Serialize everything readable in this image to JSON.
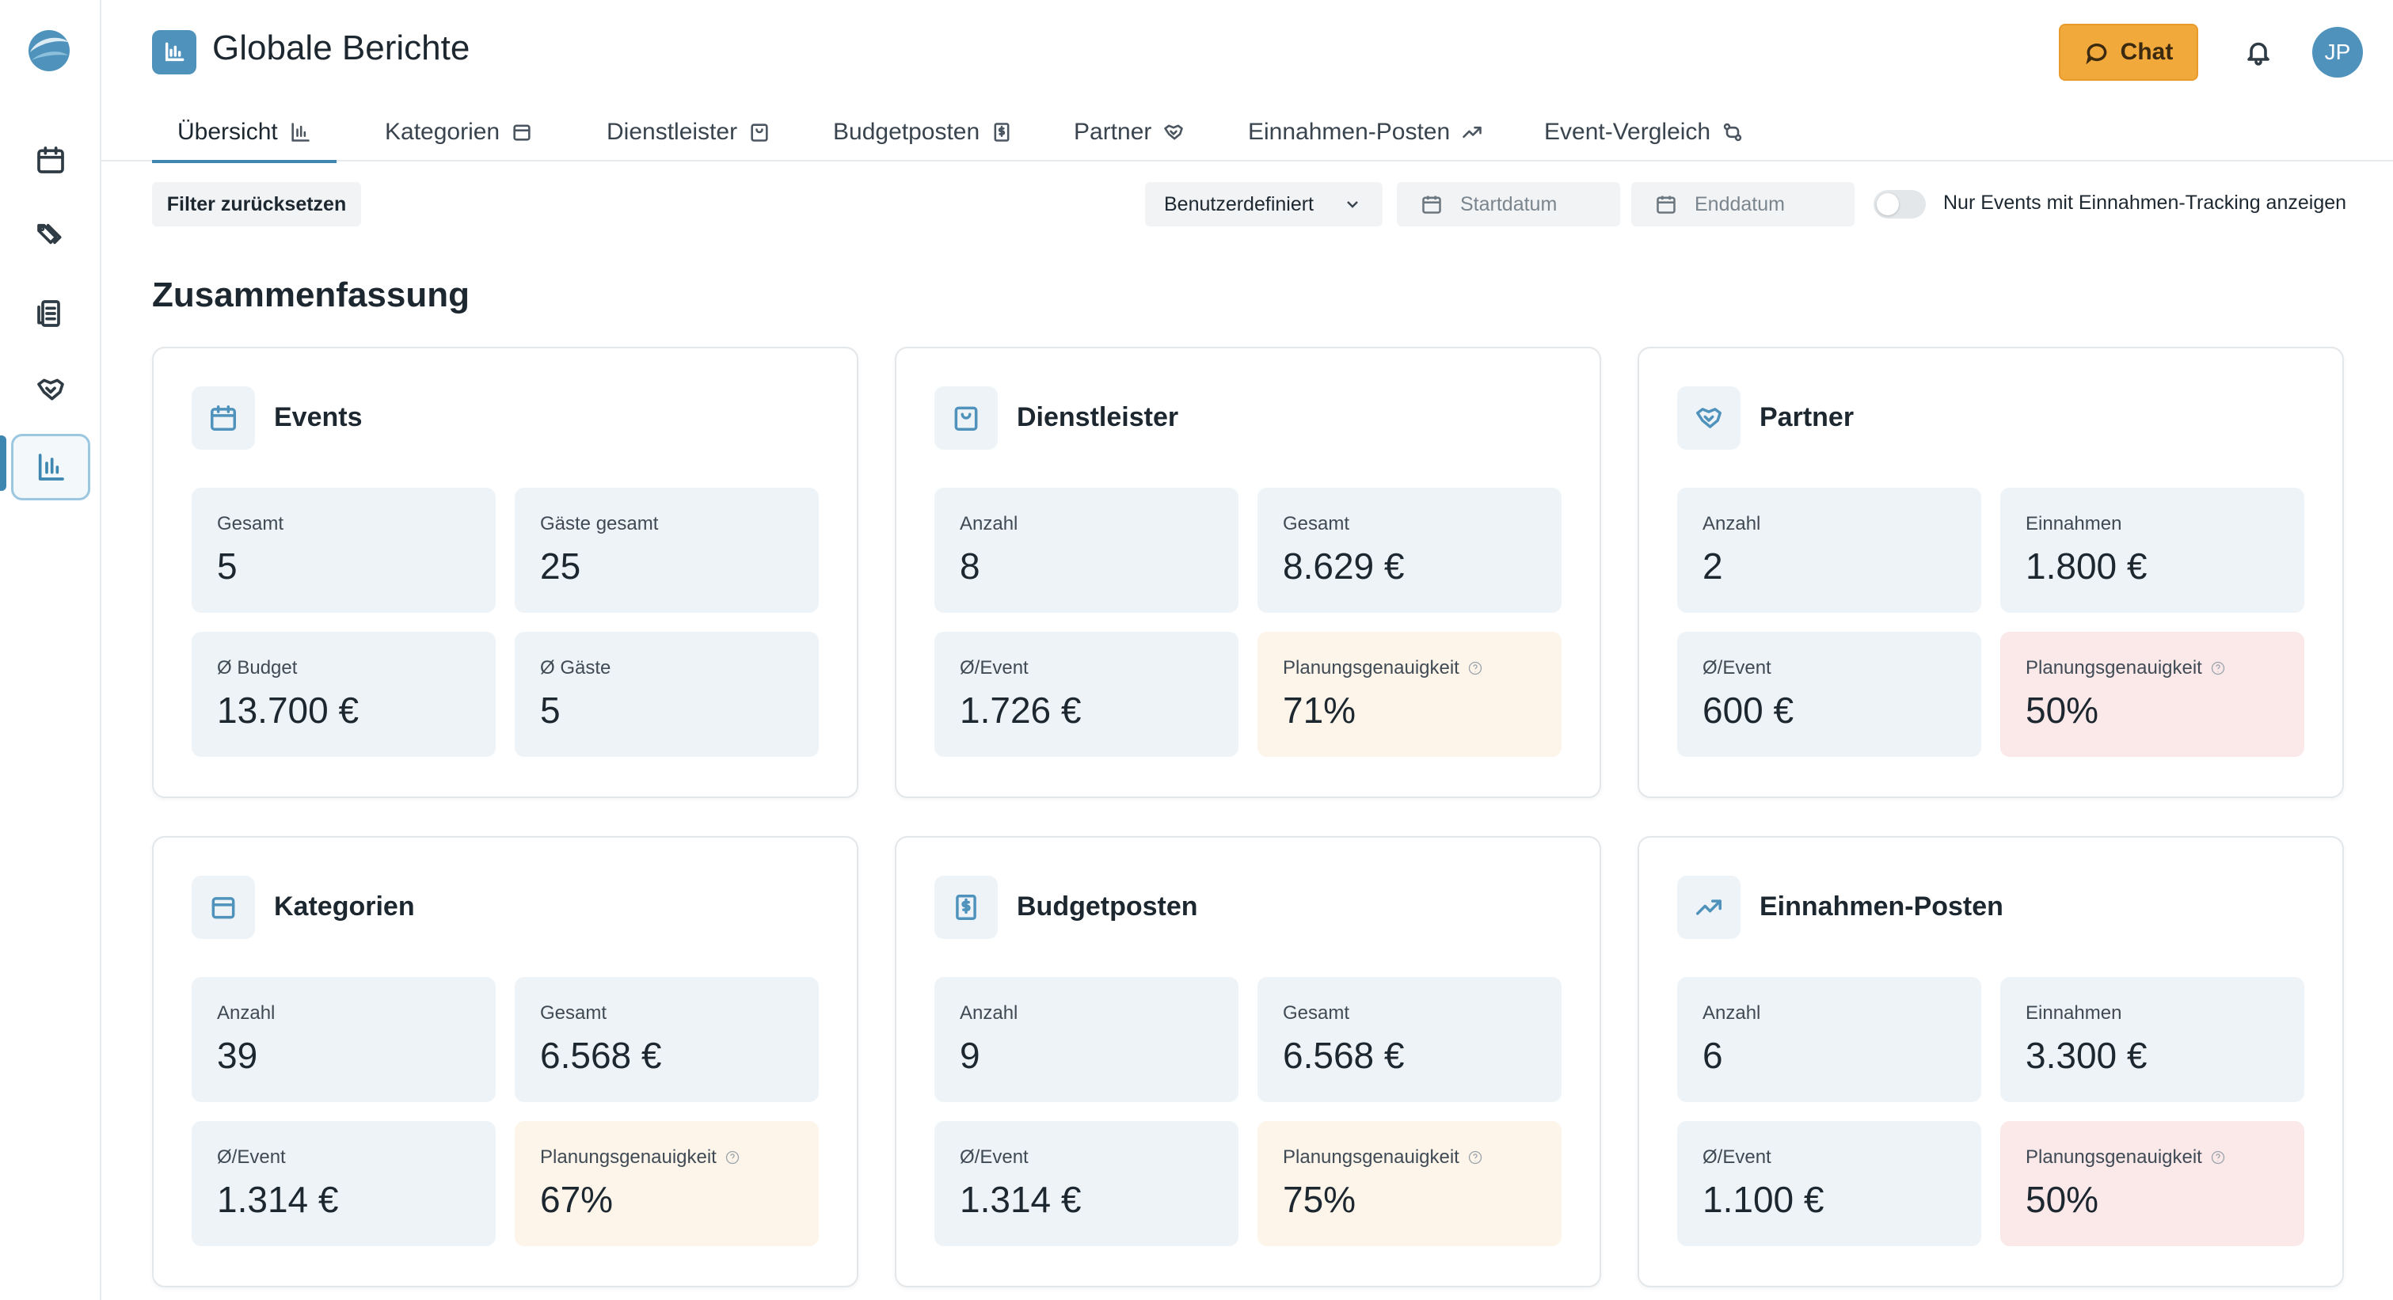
{
  "header": {
    "title": "Globale Berichte",
    "chat_label": "Chat",
    "avatar_initials": "JP"
  },
  "tabs": [
    {
      "label": "Übersicht",
      "icon": "bar-chart-icon"
    },
    {
      "label": "Kategorien",
      "icon": "archive-icon"
    },
    {
      "label": "Dienstleister",
      "icon": "shopping-bag-icon"
    },
    {
      "label": "Budgetposten",
      "icon": "receipt-dollar-icon"
    },
    {
      "label": "Partner",
      "icon": "handshake-icon"
    },
    {
      "label": "Einnahmen-Posten",
      "icon": "trending-up-icon"
    },
    {
      "label": "Event-Vergleich",
      "icon": "compare-icon"
    }
  ],
  "filters": {
    "reset_label": "Filter zurücksetzen",
    "range_value": "Benutzerdefiniert",
    "start_placeholder": "Startdatum",
    "end_placeholder": "Enddatum",
    "toggle_label": "Nur Events mit Einnahmen-Tracking anzeigen"
  },
  "summary": {
    "title": "Zusammenfassung",
    "cards": [
      {
        "title": "Events",
        "stats": [
          {
            "label": "Gesamt",
            "value": "5"
          },
          {
            "label": "Gäste gesamt",
            "value": "25"
          },
          {
            "label": "Ø Budget",
            "value": "13.700 €"
          },
          {
            "label": "Ø Gäste",
            "value": "5"
          }
        ]
      },
      {
        "title": "Dienstleister",
        "stats": [
          {
            "label": "Anzahl",
            "value": "8"
          },
          {
            "label": "Gesamt",
            "value": "8.629 €"
          },
          {
            "label": "Ø/Event",
            "value": "1.726 €"
          },
          {
            "label": "Planungsgenauigkeit",
            "value": "71%"
          }
        ]
      },
      {
        "title": "Partner",
        "stats": [
          {
            "label": "Anzahl",
            "value": "2"
          },
          {
            "label": "Einnahmen",
            "value": "1.800 €"
          },
          {
            "label": "Ø/Event",
            "value": "600 €"
          },
          {
            "label": "Planungsgenauigkeit",
            "value": "50%"
          }
        ]
      },
      {
        "title": "Kategorien",
        "stats": [
          {
            "label": "Anzahl",
            "value": "39"
          },
          {
            "label": "Gesamt",
            "value": "6.568 €"
          },
          {
            "label": "Ø/Event",
            "value": "1.314 €"
          },
          {
            "label": "Planungsgenauigkeit",
            "value": "67%"
          }
        ]
      },
      {
        "title": "Budgetposten",
        "stats": [
          {
            "label": "Anzahl",
            "value": "9"
          },
          {
            "label": "Gesamt",
            "value": "6.568 €"
          },
          {
            "label": "Ø/Event",
            "value": "1.314 €"
          },
          {
            "label": "Planungsgenauigkeit",
            "value": "75%"
          }
        ]
      },
      {
        "title": "Einnahmen-Posten",
        "stats": [
          {
            "label": "Anzahl",
            "value": "6"
          },
          {
            "label": "Einnahmen",
            "value": "3.300 €"
          },
          {
            "label": "Ø/Event",
            "value": "1.100 €"
          },
          {
            "label": "Planungsgenauigkeit",
            "value": "50%"
          }
        ]
      }
    ]
  },
  "colors": {
    "accent": "#3d87b1",
    "chat": "#f2a93b",
    "stat_bg": "#eef3f7",
    "warn_bg": "#fdf5ea",
    "danger_bg": "#fbe9ea"
  }
}
